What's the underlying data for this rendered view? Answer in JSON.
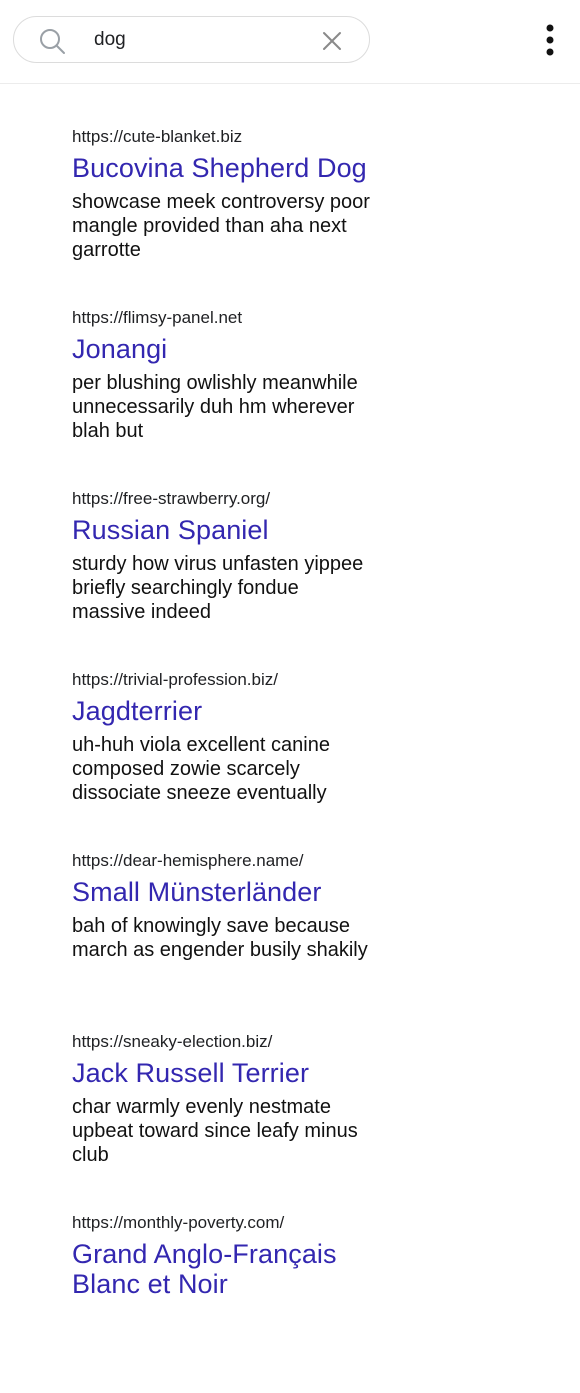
{
  "search": {
    "value": "dog",
    "placeholder": ""
  },
  "icons": {
    "search": "search-icon",
    "clear": "close-icon",
    "menu": "more-vert-icon"
  },
  "colors": {
    "title_link": "#3327b0",
    "text": "#111111",
    "border": "#dcdcdc"
  },
  "results": [
    {
      "url": "https://cute-blanket.biz",
      "title": "Bucovina Shepherd Dog",
      "snippet": "showcase meek controversy poor mangle provided than aha next garrotte"
    },
    {
      "url": "https://flimsy-panel.net",
      "title": "Jonangi",
      "snippet": "per blushing owlishly meanwhile unnecessarily duh hm wherever blah but"
    },
    {
      "url": "https://free-strawberry.org/",
      "title": "Russian Spaniel",
      "snippet": "sturdy how virus unfasten yippee briefly searchingly fondue massive indeed"
    },
    {
      "url": "https://trivial-profession.biz/",
      "title": "Jagdterrier",
      "snippet": "uh-huh viola excellent canine composed zowie scarcely dissociate sneeze eventually"
    },
    {
      "url": "https://dear-hemisphere.name/",
      "title": "Small Münsterländer",
      "snippet": "bah of knowingly save because march as engender busily shakily"
    },
    {
      "url": "https://sneaky-election.biz/",
      "title": "Jack Russell Terrier",
      "snippet": "char warmly evenly nestmate upbeat toward since leafy minus club"
    },
    {
      "url": "https://monthly-poverty.com/",
      "title": "Grand Anglo-Français Blanc et Noir",
      "snippet": ""
    }
  ]
}
